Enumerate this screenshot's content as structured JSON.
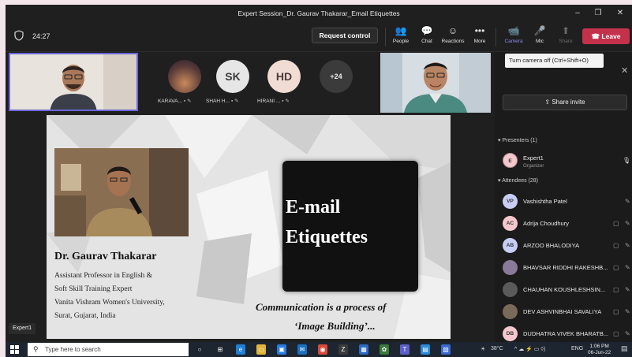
{
  "window": {
    "title": "Expert Session_Dr. Gaurav Thakarar_Email Etiquettes",
    "minimize_glyph": "–",
    "maximize_glyph": "❐",
    "close_glyph": "✕"
  },
  "meeting": {
    "timer": "24:27",
    "request_control_label": "Request control",
    "buttons": [
      {
        "label": "People",
        "icon": "people-icon",
        "glyph": "👥"
      },
      {
        "label": "Chat",
        "icon": "chat-icon",
        "glyph": "💬"
      },
      {
        "label": "Reactions",
        "icon": "reactions-icon",
        "glyph": "☺"
      },
      {
        "label": "More",
        "icon": "more-icon",
        "glyph": "•••"
      },
      {
        "label": "Camera",
        "icon": "camera-icon",
        "glyph": "📹"
      },
      {
        "label": "Mic",
        "icon": "mic-off-icon",
        "glyph": "🎤"
      },
      {
        "label": "Share",
        "icon": "share-icon",
        "glyph": "⬆"
      }
    ],
    "leave_label": "Leave",
    "leave_color": "#c4314b",
    "tooltip": "Turn camera off (Ctrl+Shift+O)"
  },
  "participants_strip": {
    "tiles": [
      {
        "name": "KARAVA...",
        "initials": "",
        "color": "#6b4a3a"
      },
      {
        "name": "SHAH H...",
        "initials": "SK",
        "color": "#e6e6e6"
      },
      {
        "name": "HIRANI ...",
        "initials": "HD",
        "color": "#f0dcd3"
      },
      {
        "name": "",
        "initials": "+24",
        "color": "#3b3b3b"
      }
    ]
  },
  "slide": {
    "presenter_name": "Dr. Gaurav Thakarar",
    "bio_lines": [
      "Assistant Professor in English &",
      "Soft Skill Training Expert",
      "Vanita Vishram Women's University,",
      "Surat, Gujarat, India"
    ],
    "title_line1": "E-mail",
    "title_line2": "Etiquettes",
    "quote_line1": "Communication is a process of",
    "quote_line2": "‘Image Building’...",
    "presenter_tag": "Expert1"
  },
  "panel": {
    "close_glyph": "✕",
    "share_invite_label": "Share invite",
    "presenters_header": "Presenters (1)",
    "presenter": {
      "name": "Expert1",
      "role": "Organizer",
      "initials": "E"
    },
    "attendees_header": "Attendees (28)",
    "attendees": [
      {
        "name": "Vashishtha Patel",
        "initials": "VP",
        "color": "#c7cdf5"
      },
      {
        "name": "Adrija Choudhury",
        "initials": "AC",
        "color": "#f4c7cf"
      },
      {
        "name": "ARZOO BHALODIYA",
        "initials": "AB",
        "color": "#c7cdf5"
      },
      {
        "name": "BHAVSAR RIDDHI RAKESHB...",
        "initials": "",
        "color": "#8a7a9a"
      },
      {
        "name": "CHAUHAN KOUSHLESHSIN...",
        "initials": "",
        "color": "#5a5a5a"
      },
      {
        "name": "DEV ASHVINBHAI SAVALIYA",
        "initials": "",
        "color": "#7a6a5a"
      },
      {
        "name": "DUDHATRA VIVEK BHARATB...",
        "initials": "DB",
        "color": "#f4c7cf"
      }
    ]
  },
  "taskbar": {
    "search_placeholder": "Type here to search",
    "weather": "38°C",
    "language": "ENG",
    "time": "1:06 PM",
    "date": "06-Jun-22"
  }
}
